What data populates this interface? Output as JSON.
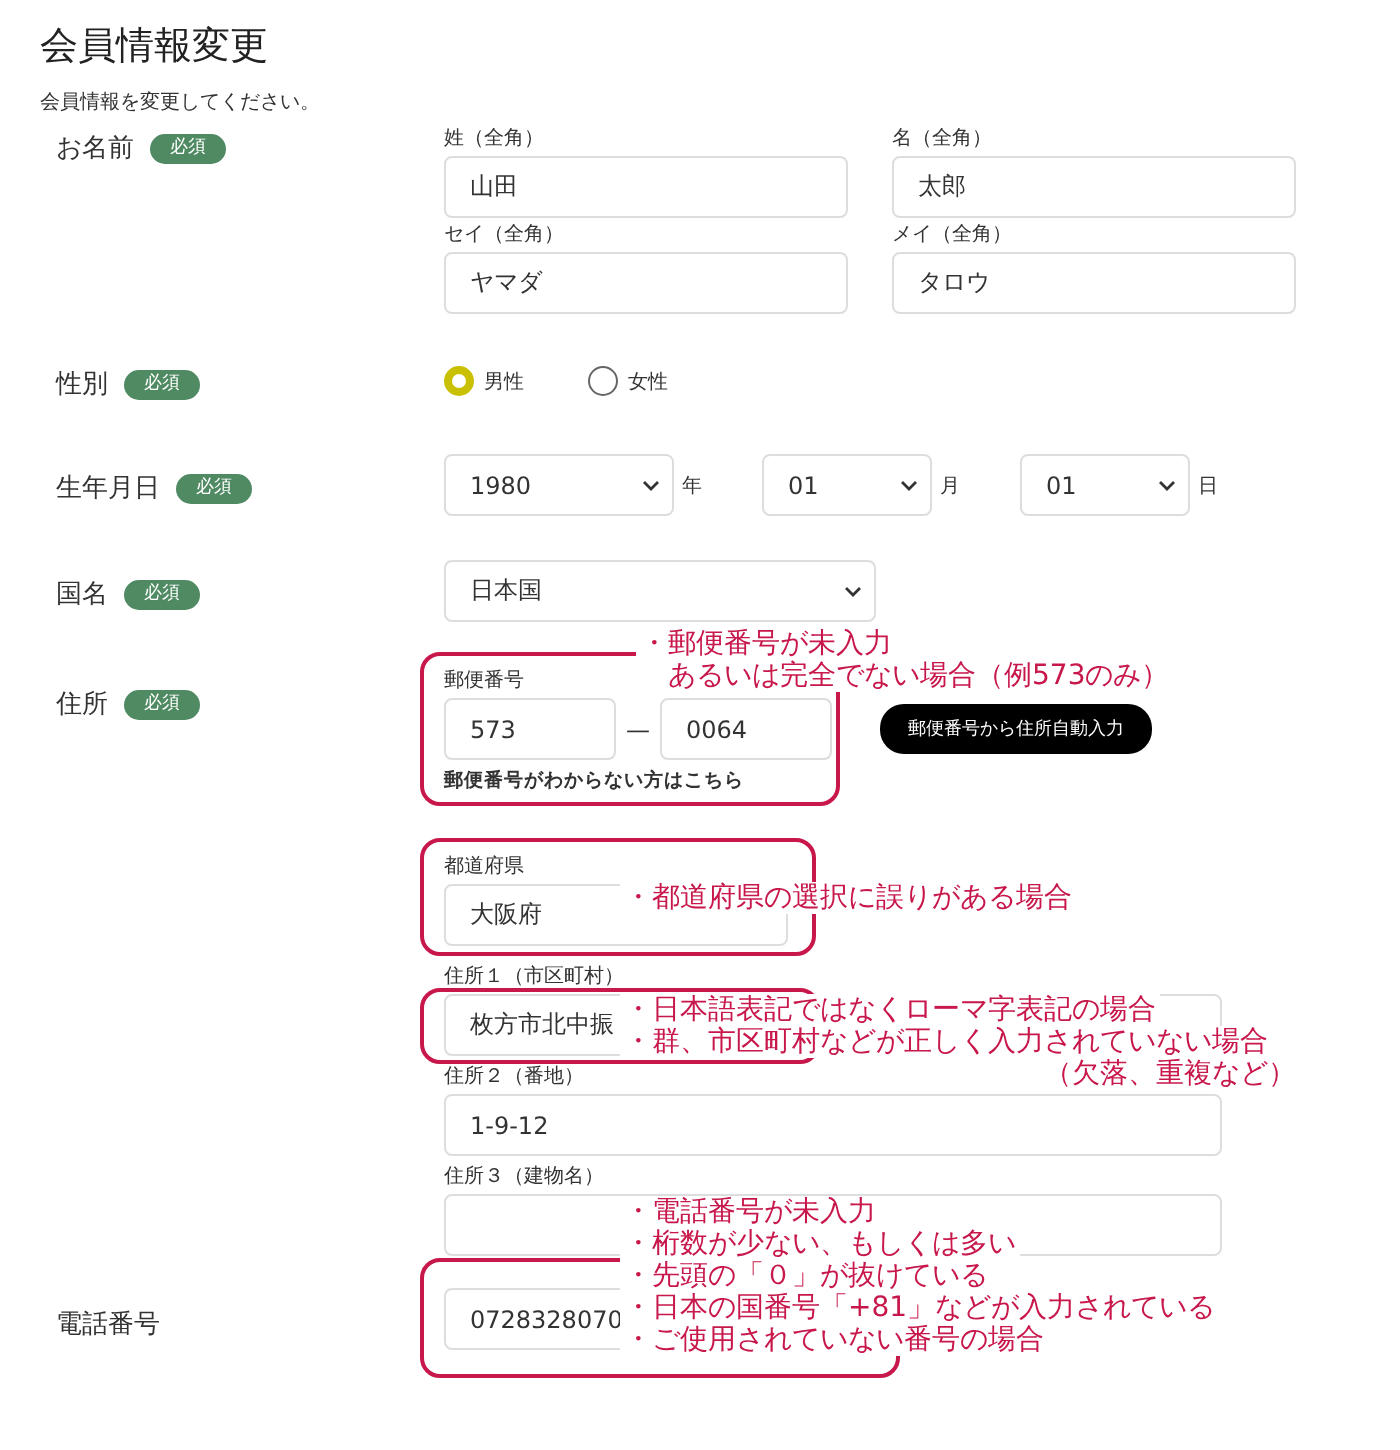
{
  "title": "会員情報変更",
  "description": "会員情報を変更してください。",
  "rows": [
    {
      "kind": "name",
      "label": "お名前",
      "badge": "必須",
      "fields": [
        {
          "label": "姓（全角）",
          "value": "山田"
        },
        {
          "label": "名（全角）",
          "value": "太郎"
        },
        {
          "label": "セイ（全角）",
          "value": "ヤマダ"
        },
        {
          "label": "メイ（全角）",
          "value": "タロウ"
        }
      ]
    },
    {
      "kind": "radio",
      "label": "性別",
      "badge": "必須",
      "options": [
        {
          "label": "男性",
          "selected": true
        },
        {
          "label": "女性",
          "selected": false
        }
      ]
    },
    {
      "kind": "date",
      "label": "生年月日",
      "badge": "必須",
      "selects": [
        {
          "value": "1980",
          "unit": "年"
        },
        {
          "value": "01",
          "unit": "月"
        },
        {
          "value": "01",
          "unit": "日"
        }
      ]
    },
    {
      "kind": "select",
      "label": "国名",
      "badge": "必須",
      "value": "日本国"
    },
    {
      "kind": "address",
      "label": "住所",
      "badge": "必須",
      "postal": {
        "label": "郵便番号",
        "part1": "573",
        "dash": "—",
        "part2": "0064",
        "button": "郵便番号から住所自動入力",
        "link": "郵便番号がわからない方はこちら",
        "annotation": [
          {
            "kind": "bullet",
            "text": "・郵便番号が未入力"
          },
          {
            "kind": "continued",
            "text": "あるいは完全でない場合（例573のみ）"
          }
        ]
      },
      "prefecture": {
        "label": "都道府県",
        "value": "大阪府",
        "annotation": [
          {
            "kind": "bullet",
            "text": "・都道府県の選択に誤りがある場合"
          }
        ]
      },
      "lines": [
        {
          "label": "住所１（市区町村）",
          "value": "枚方市北中振",
          "annotation": [
            {
              "kind": "bullet",
              "text": "・日本語表記ではなくローマ字表記の場合"
            },
            {
              "kind": "bullet",
              "text": "・群、市区町村などが正しく入力されていない場合"
            },
            {
              "kind": "trailing",
              "text": "（欠落、重複など）"
            }
          ]
        },
        {
          "label": "住所２（番地）",
          "value": "1-9-12"
        },
        {
          "label": "住所３（建物名）"
        }
      ]
    },
    {
      "kind": "phone",
      "label": "電話番号",
      "value": "0728328070",
      "annotation": [
        {
          "kind": "bullet",
          "text": "・電話番号が未入力"
        },
        {
          "kind": "bullet",
          "text": "・桁数が少ない、もしくは多い"
        },
        {
          "kind": "bullet",
          "text": "・先頭の「０」が抜けている"
        },
        {
          "kind": "bullet",
          "text": "・日本の国番号「+81」などが入力されている"
        },
        {
          "kind": "bullet",
          "text": "・ご使用されていない番号の場合"
        }
      ]
    }
  ]
}
